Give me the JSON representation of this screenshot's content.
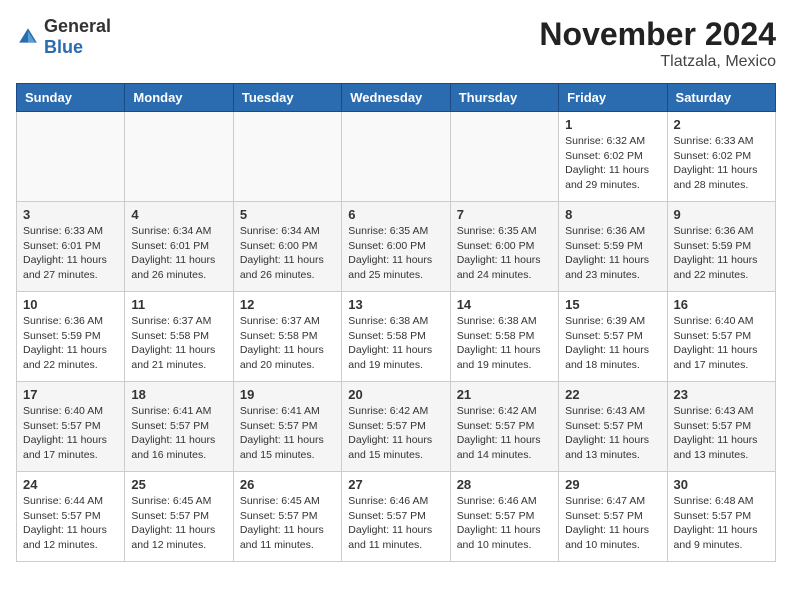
{
  "logo": {
    "general": "General",
    "blue": "Blue"
  },
  "title": "November 2024",
  "location": "Tlatzala, Mexico",
  "days_of_week": [
    "Sunday",
    "Monday",
    "Tuesday",
    "Wednesday",
    "Thursday",
    "Friday",
    "Saturday"
  ],
  "weeks": [
    [
      {
        "day": "",
        "info": ""
      },
      {
        "day": "",
        "info": ""
      },
      {
        "day": "",
        "info": ""
      },
      {
        "day": "",
        "info": ""
      },
      {
        "day": "",
        "info": ""
      },
      {
        "day": "1",
        "info": "Sunrise: 6:32 AM\nSunset: 6:02 PM\nDaylight: 11 hours and 29 minutes."
      },
      {
        "day": "2",
        "info": "Sunrise: 6:33 AM\nSunset: 6:02 PM\nDaylight: 11 hours and 28 minutes."
      }
    ],
    [
      {
        "day": "3",
        "info": "Sunrise: 6:33 AM\nSunset: 6:01 PM\nDaylight: 11 hours and 27 minutes."
      },
      {
        "day": "4",
        "info": "Sunrise: 6:34 AM\nSunset: 6:01 PM\nDaylight: 11 hours and 26 minutes."
      },
      {
        "day": "5",
        "info": "Sunrise: 6:34 AM\nSunset: 6:00 PM\nDaylight: 11 hours and 26 minutes."
      },
      {
        "day": "6",
        "info": "Sunrise: 6:35 AM\nSunset: 6:00 PM\nDaylight: 11 hours and 25 minutes."
      },
      {
        "day": "7",
        "info": "Sunrise: 6:35 AM\nSunset: 6:00 PM\nDaylight: 11 hours and 24 minutes."
      },
      {
        "day": "8",
        "info": "Sunrise: 6:36 AM\nSunset: 5:59 PM\nDaylight: 11 hours and 23 minutes."
      },
      {
        "day": "9",
        "info": "Sunrise: 6:36 AM\nSunset: 5:59 PM\nDaylight: 11 hours and 22 minutes."
      }
    ],
    [
      {
        "day": "10",
        "info": "Sunrise: 6:36 AM\nSunset: 5:59 PM\nDaylight: 11 hours and 22 minutes."
      },
      {
        "day": "11",
        "info": "Sunrise: 6:37 AM\nSunset: 5:58 PM\nDaylight: 11 hours and 21 minutes."
      },
      {
        "day": "12",
        "info": "Sunrise: 6:37 AM\nSunset: 5:58 PM\nDaylight: 11 hours and 20 minutes."
      },
      {
        "day": "13",
        "info": "Sunrise: 6:38 AM\nSunset: 5:58 PM\nDaylight: 11 hours and 19 minutes."
      },
      {
        "day": "14",
        "info": "Sunrise: 6:38 AM\nSunset: 5:58 PM\nDaylight: 11 hours and 19 minutes."
      },
      {
        "day": "15",
        "info": "Sunrise: 6:39 AM\nSunset: 5:57 PM\nDaylight: 11 hours and 18 minutes."
      },
      {
        "day": "16",
        "info": "Sunrise: 6:40 AM\nSunset: 5:57 PM\nDaylight: 11 hours and 17 minutes."
      }
    ],
    [
      {
        "day": "17",
        "info": "Sunrise: 6:40 AM\nSunset: 5:57 PM\nDaylight: 11 hours and 17 minutes."
      },
      {
        "day": "18",
        "info": "Sunrise: 6:41 AM\nSunset: 5:57 PM\nDaylight: 11 hours and 16 minutes."
      },
      {
        "day": "19",
        "info": "Sunrise: 6:41 AM\nSunset: 5:57 PM\nDaylight: 11 hours and 15 minutes."
      },
      {
        "day": "20",
        "info": "Sunrise: 6:42 AM\nSunset: 5:57 PM\nDaylight: 11 hours and 15 minutes."
      },
      {
        "day": "21",
        "info": "Sunrise: 6:42 AM\nSunset: 5:57 PM\nDaylight: 11 hours and 14 minutes."
      },
      {
        "day": "22",
        "info": "Sunrise: 6:43 AM\nSunset: 5:57 PM\nDaylight: 11 hours and 13 minutes."
      },
      {
        "day": "23",
        "info": "Sunrise: 6:43 AM\nSunset: 5:57 PM\nDaylight: 11 hours and 13 minutes."
      }
    ],
    [
      {
        "day": "24",
        "info": "Sunrise: 6:44 AM\nSunset: 5:57 PM\nDaylight: 11 hours and 12 minutes."
      },
      {
        "day": "25",
        "info": "Sunrise: 6:45 AM\nSunset: 5:57 PM\nDaylight: 11 hours and 12 minutes."
      },
      {
        "day": "26",
        "info": "Sunrise: 6:45 AM\nSunset: 5:57 PM\nDaylight: 11 hours and 11 minutes."
      },
      {
        "day": "27",
        "info": "Sunrise: 6:46 AM\nSunset: 5:57 PM\nDaylight: 11 hours and 11 minutes."
      },
      {
        "day": "28",
        "info": "Sunrise: 6:46 AM\nSunset: 5:57 PM\nDaylight: 11 hours and 10 minutes."
      },
      {
        "day": "29",
        "info": "Sunrise: 6:47 AM\nSunset: 5:57 PM\nDaylight: 11 hours and 10 minutes."
      },
      {
        "day": "30",
        "info": "Sunrise: 6:48 AM\nSunset: 5:57 PM\nDaylight: 11 hours and 9 minutes."
      }
    ]
  ]
}
